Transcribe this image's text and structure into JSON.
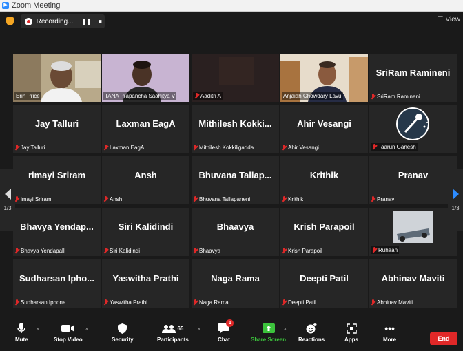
{
  "window": {
    "title": "Zoom Meeting"
  },
  "topbar": {
    "recording_label": "Recording...",
    "view_label": "View"
  },
  "pagination": {
    "left_page": "1/3",
    "right_page": "1/3"
  },
  "tiles": [
    {
      "big": "",
      "small": "Erin Price",
      "video": "erin"
    },
    {
      "big": "",
      "small": "TANA Prapancha Saahitya V",
      "video": "tana"
    },
    {
      "big": "",
      "small": "Aaditri A",
      "video": "dark"
    },
    {
      "big": "",
      "small": "Anjaiah Chowdary Lavu",
      "video": "anjaiah"
    },
    {
      "big": "SriRam Ramineni",
      "small": "SriRam Ramineni",
      "video": ""
    },
    {
      "big": "Jay Talluri",
      "small": "Jay Talluri",
      "video": ""
    },
    {
      "big": "Laxman EagA",
      "small": "Laxman EagA",
      "video": ""
    },
    {
      "big": "Mithilesh Kokki...",
      "small": "Mithilesh Kokkiligadda",
      "video": ""
    },
    {
      "big": "Ahir Vesangi",
      "small": "Ahir Vesangi",
      "video": ""
    },
    {
      "big": "",
      "small": "Taarun Ganesh",
      "video": "taarun"
    },
    {
      "big": "rimayi Sriram",
      "small": "imayi Sriram",
      "video": ""
    },
    {
      "big": "Ansh",
      "small": "Ansh",
      "video": ""
    },
    {
      "big": "Bhuvana Tallap...",
      "small": "Bhuvana Tallapaneni",
      "video": ""
    },
    {
      "big": "Krithik",
      "small": "Krithik",
      "video": ""
    },
    {
      "big": "Pranav",
      "small": "Pranav",
      "video": ""
    },
    {
      "big": "Bhavya Yendap...",
      "small": "Bhavya Yendapalli",
      "video": ""
    },
    {
      "big": "Siri Kalidindi",
      "small": "Siri Kalidindi",
      "video": ""
    },
    {
      "big": "Bhaavya",
      "small": "Bhaavya",
      "video": ""
    },
    {
      "big": "Krish Parapoil",
      "small": "Krish Parapoil",
      "video": ""
    },
    {
      "big": "",
      "small": "Ruhaan",
      "video": "ruhaan"
    },
    {
      "big": "Sudharsan Ipho...",
      "small": "Sudharsan Iphone",
      "video": ""
    },
    {
      "big": "Yaswitha Prathi",
      "small": "Yaswitha Prathi",
      "video": ""
    },
    {
      "big": "Naga Rama",
      "small": "Naga Rama",
      "video": ""
    },
    {
      "big": "Deepti Patil",
      "small": "Deepti Patil",
      "video": ""
    },
    {
      "big": "Abhinav Maviti",
      "small": "Abhinav Maviti",
      "video": ""
    }
  ],
  "toolbar": {
    "mute": "Mute",
    "stop_video": "Stop Video",
    "security": "Security",
    "participants": "Participants",
    "participants_count": "65",
    "chat": "Chat",
    "chat_badge": "1",
    "share_screen": "Share Screen",
    "reactions": "Reactions",
    "apps": "Apps",
    "more": "More",
    "end": "End"
  },
  "colors": {
    "active_speaker": "#a8d64b",
    "share_green": "#3cc33c",
    "end_red": "#e02828",
    "zoom_blue": "#2d8cff"
  }
}
